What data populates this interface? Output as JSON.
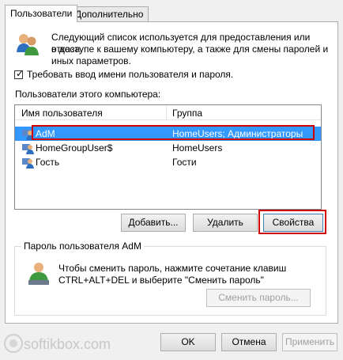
{
  "tabs": [
    {
      "label": "Пользователи",
      "active": true
    },
    {
      "label": "Дополнительно",
      "active": false
    }
  ],
  "intro": {
    "line1": "Следующий список используется для предоставления или отказа",
    "line2": "в доступе к вашему компьютеру, а также для смены паролей и",
    "line3": "иных параметров."
  },
  "require_login": {
    "label": "Требовать ввод имени пользователя и пароля.",
    "checked": true
  },
  "users_section_label": "Пользователи этого компьютера:",
  "table": {
    "columns": [
      "Имя пользователя",
      "Группа"
    ],
    "rows": [
      {
        "name": "AdM",
        "group": "HomeUsers; Администраторы",
        "selected": true
      },
      {
        "name": "HomeGroupUser$",
        "group": "HomeUsers",
        "selected": false
      },
      {
        "name": "Гость",
        "group": "Гости",
        "selected": false
      }
    ]
  },
  "buttons": {
    "add": "Добавить...",
    "remove": "Удалить",
    "properties": "Свойства"
  },
  "password_group": {
    "title": "Пароль пользователя AdM",
    "text_line1": "Чтобы сменить пароль, нажмите сочетание клавиш",
    "text_line2": "CTRL+ALT+DEL и выберите \"Сменить пароль\"",
    "change_button": "Сменить пароль..."
  },
  "footer": {
    "ok": "OK",
    "cancel": "Отмена",
    "apply": "Применить"
  },
  "watermark": "softikbox.com",
  "colors": {
    "selection": "#3399ff",
    "highlight_box": "#d10000"
  }
}
